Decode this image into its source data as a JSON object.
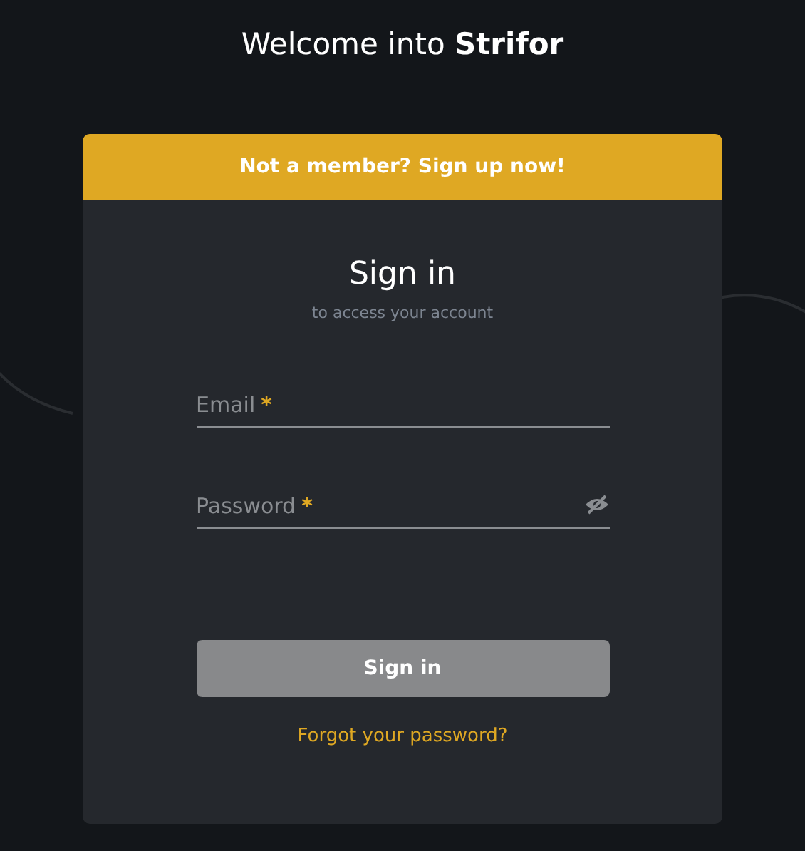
{
  "heading": "Welcome into **Strifor**",
  "banner": {
    "text": "Not a member? Sign up now!"
  },
  "form": {
    "title": "Sign in",
    "subtitle": "to access your account",
    "fields": [
      {
        "kind": "text",
        "placeholder": "Email",
        "mark": "*"
      },
      {
        "kind": "password",
        "placeholder": "Password",
        "mark": "*"
      }
    ],
    "submit": {
      "label": "Sign in",
      "disabled": true
    },
    "forgot_link": "Forgot your password?"
  }
}
